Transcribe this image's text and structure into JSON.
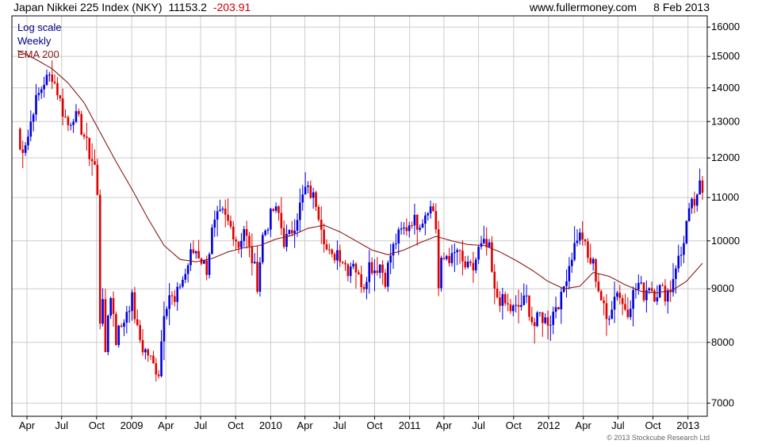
{
  "header": {
    "title": "Japan Nikkei 225 Index (NKY)",
    "last": "11153.2",
    "change": "-203.91",
    "site": "www.fullermoney.com",
    "date": "8 Feb 2013"
  },
  "legend": {
    "scale": "Log scale",
    "period": "Weekly",
    "ema": "EMA 200"
  },
  "copyright": "© 2013 Stockcube Research Ltd",
  "colors": {
    "up": "#0000dd",
    "down": "#dd0000",
    "ema": "#8b1a1a",
    "grid": "#cccccc",
    "scale_text": "#00008b",
    "ema_text": "#8b1a1a",
    "change_text": "#cc0000"
  },
  "chart_data": {
    "type": "candlestick",
    "scale": "log",
    "ylim": [
      6800,
      16400
    ],
    "y_ticks": [
      7000,
      8000,
      9000,
      10000,
      11000,
      12000,
      13000,
      14000,
      15000,
      16000
    ],
    "y_tick_labels": [
      "7000",
      "8000",
      "9000",
      "10000",
      "11000",
      "12000",
      "13000",
      "14000",
      "15000",
      "16000"
    ],
    "x_start": "2008-03-07",
    "x_end": "2013-02-08",
    "x_ticks": [
      {
        "date": "2008-04-01",
        "label": "Apr"
      },
      {
        "date": "2008-07-01",
        "label": "Jul"
      },
      {
        "date": "2008-10-01",
        "label": "Oct"
      },
      {
        "date": "2009-01-01",
        "label": "2009"
      },
      {
        "date": "2009-04-01",
        "label": "Apr"
      },
      {
        "date": "2009-07-01",
        "label": "Jul"
      },
      {
        "date": "2009-10-01",
        "label": "Oct"
      },
      {
        "date": "2010-01-01",
        "label": "2010"
      },
      {
        "date": "2010-04-01",
        "label": "Apr"
      },
      {
        "date": "2010-07-01",
        "label": "Jul"
      },
      {
        "date": "2010-10-01",
        "label": "Oct"
      },
      {
        "date": "2011-01-01",
        "label": "2011"
      },
      {
        "date": "2011-04-01",
        "label": "Apr"
      },
      {
        "date": "2011-07-01",
        "label": "Jul"
      },
      {
        "date": "2011-10-01",
        "label": "Oct"
      },
      {
        "date": "2012-01-01",
        "label": "2012"
      },
      {
        "date": "2012-04-01",
        "label": "Apr"
      },
      {
        "date": "2012-07-01",
        "label": "Jul"
      },
      {
        "date": "2012-10-01",
        "label": "Oct"
      },
      {
        "date": "2013-01-01",
        "label": "2013"
      }
    ],
    "close_path": [
      [
        "2008-03-07",
        12800
      ],
      [
        "2008-03-14",
        12200
      ],
      [
        "2008-03-21",
        12300
      ],
      [
        "2008-04-04",
        12600
      ],
      [
        "2008-04-18",
        13400
      ],
      [
        "2008-05-02",
        13800
      ],
      [
        "2008-05-16",
        14200
      ],
      [
        "2008-06-06",
        14400
      ],
      [
        "2008-06-20",
        13900
      ],
      [
        "2008-07-04",
        13300
      ],
      [
        "2008-07-18",
        12900
      ],
      [
        "2008-08-01",
        13200
      ],
      [
        "2008-08-15",
        13000
      ],
      [
        "2008-08-29",
        12600
      ],
      [
        "2008-09-12",
        12100
      ],
      [
        "2008-09-26",
        11800
      ],
      [
        "2008-10-03",
        11000
      ],
      [
        "2008-10-10",
        8400
      ],
      [
        "2008-10-17",
        8900
      ],
      [
        "2008-10-24",
        7700
      ],
      [
        "2008-10-31",
        8500
      ],
      [
        "2008-11-07",
        8900
      ],
      [
        "2008-11-14",
        8500
      ],
      [
        "2008-11-21",
        8000
      ],
      [
        "2008-11-28",
        8400
      ],
      [
        "2008-12-05",
        8200
      ],
      [
        "2008-12-19",
        8600
      ],
      [
        "2009-01-02",
        8800
      ],
      [
        "2009-01-16",
        8200
      ],
      [
        "2009-01-30",
        7900
      ],
      [
        "2009-02-13",
        7800
      ],
      [
        "2009-02-27",
        7600
      ],
      [
        "2009-03-13",
        7500
      ],
      [
        "2009-03-27",
        8600
      ],
      [
        "2009-04-10",
        8900
      ],
      [
        "2009-04-24",
        8700
      ],
      [
        "2009-05-08",
        9100
      ],
      [
        "2009-05-22",
        9300
      ],
      [
        "2009-06-05",
        9700
      ],
      [
        "2009-06-19",
        9800
      ],
      [
        "2009-07-03",
        9600
      ],
      [
        "2009-07-17",
        9400
      ],
      [
        "2009-07-31",
        10200
      ],
      [
        "2009-08-14",
        10500
      ],
      [
        "2009-08-28",
        10600
      ],
      [
        "2009-09-11",
        10400
      ],
      [
        "2009-09-25",
        10200
      ],
      [
        "2009-10-09",
        9900
      ],
      [
        "2009-10-23",
        10300
      ],
      [
        "2009-11-06",
        9800
      ],
      [
        "2009-11-20",
        9400
      ],
      [
        "2009-11-27",
        9100
      ],
      [
        "2009-12-11",
        10100
      ],
      [
        "2009-12-25",
        10400
      ],
      [
        "2010-01-08",
        10700
      ],
      [
        "2010-01-22",
        10600
      ],
      [
        "2010-02-05",
        10000
      ],
      [
        "2010-02-19",
        10100
      ],
      [
        "2010-03-05",
        10400
      ],
      [
        "2010-03-19",
        10800
      ],
      [
        "2010-04-02",
        11200
      ],
      [
        "2010-04-16",
        11100
      ],
      [
        "2010-04-30",
        10900
      ],
      [
        "2010-05-14",
        10400
      ],
      [
        "2010-05-28",
        9800
      ],
      [
        "2010-06-11",
        9600
      ],
      [
        "2010-06-25",
        9800
      ],
      [
        "2010-07-09",
        9600
      ],
      [
        "2010-07-23",
        9400
      ],
      [
        "2010-08-06",
        9600
      ],
      [
        "2010-08-20",
        9200
      ],
      [
        "2010-09-03",
        9100
      ],
      [
        "2010-09-17",
        9500
      ],
      [
        "2010-10-01",
        9400
      ],
      [
        "2010-10-15",
        9500
      ],
      [
        "2010-10-29",
        9200
      ],
      [
        "2010-11-12",
        9700
      ],
      [
        "2010-11-26",
        10000
      ],
      [
        "2010-12-10",
        10200
      ],
      [
        "2010-12-24",
        10300
      ],
      [
        "2011-01-07",
        10500
      ],
      [
        "2011-01-21",
        10400
      ],
      [
        "2011-02-04",
        10500
      ],
      [
        "2011-02-18",
        10800
      ],
      [
        "2011-03-04",
        10700
      ],
      [
        "2011-03-11",
        10300
      ],
      [
        "2011-03-18",
        9000
      ],
      [
        "2011-03-25",
        9500
      ],
      [
        "2011-04-08",
        9700
      ],
      [
        "2011-04-22",
        9600
      ],
      [
        "2011-05-06",
        9800
      ],
      [
        "2011-05-20",
        9500
      ],
      [
        "2011-06-03",
        9400
      ],
      [
        "2011-06-17",
        9400
      ],
      [
        "2011-07-01",
        9800
      ],
      [
        "2011-07-15",
        9900
      ],
      [
        "2011-07-29",
        9800
      ],
      [
        "2011-08-05",
        9300
      ],
      [
        "2011-08-12",
        8900
      ],
      [
        "2011-08-26",
        8800
      ],
      [
        "2011-09-09",
        8700
      ],
      [
        "2011-09-23",
        8600
      ],
      [
        "2011-10-07",
        8600
      ],
      [
        "2011-10-21",
        8700
      ],
      [
        "2011-11-04",
        8800
      ],
      [
        "2011-11-18",
        8400
      ],
      [
        "2011-11-25",
        8300
      ],
      [
        "2011-12-09",
        8500
      ],
      [
        "2011-12-23",
        8400
      ],
      [
        "2012-01-06",
        8400
      ],
      [
        "2012-01-20",
        8700
      ],
      [
        "2012-02-03",
        8800
      ],
      [
        "2012-02-17",
        9300
      ],
      [
        "2012-03-02",
        9700
      ],
      [
        "2012-03-16",
        10100
      ],
      [
        "2012-03-30",
        10100
      ],
      [
        "2012-04-13",
        9600
      ],
      [
        "2012-04-27",
        9500
      ],
      [
        "2012-05-11",
        9000
      ],
      [
        "2012-05-25",
        8600
      ],
      [
        "2012-06-01",
        8400
      ],
      [
        "2012-06-15",
        8700
      ],
      [
        "2012-06-29",
        9000
      ],
      [
        "2012-07-13",
        8700
      ],
      [
        "2012-07-27",
        8600
      ],
      [
        "2012-08-10",
        8900
      ],
      [
        "2012-08-24",
        9100
      ],
      [
        "2012-09-07",
        8900
      ],
      [
        "2012-09-21",
        9100
      ],
      [
        "2012-10-05",
        8900
      ],
      [
        "2012-10-19",
        9000
      ],
      [
        "2012-11-02",
        8900
      ],
      [
        "2012-11-16",
        9000
      ],
      [
        "2012-11-30",
        9500
      ],
      [
        "2012-12-14",
        9700
      ],
      [
        "2012-12-28",
        10400
      ],
      [
        "2013-01-11",
        10800
      ],
      [
        "2013-01-25",
        10900
      ],
      [
        "2013-02-01",
        11300
      ],
      [
        "2013-02-08",
        11150
      ]
    ],
    "ema_200": [
      [
        "2008-03-07",
        15200
      ],
      [
        "2008-04-25",
        14900
      ],
      [
        "2008-06-06",
        14600
      ],
      [
        "2008-07-18",
        14150
      ],
      [
        "2008-08-29",
        13550
      ],
      [
        "2008-10-10",
        12700
      ],
      [
        "2008-11-21",
        11900
      ],
      [
        "2009-01-02",
        11200
      ],
      [
        "2009-02-13",
        10500
      ],
      [
        "2009-03-27",
        9900
      ],
      [
        "2009-05-08",
        9600
      ],
      [
        "2009-06-19",
        9550
      ],
      [
        "2009-07-31",
        9620
      ],
      [
        "2009-09-11",
        9760
      ],
      [
        "2009-10-23",
        9850
      ],
      [
        "2009-12-04",
        9900
      ],
      [
        "2010-01-15",
        10040
      ],
      [
        "2010-02-26",
        10120
      ],
      [
        "2010-04-09",
        10280
      ],
      [
        "2010-05-21",
        10350
      ],
      [
        "2010-07-02",
        10200
      ],
      [
        "2010-08-13",
        10000
      ],
      [
        "2010-09-24",
        9800
      ],
      [
        "2010-11-05",
        9700
      ],
      [
        "2010-12-17",
        9800
      ],
      [
        "2011-01-28",
        9960
      ],
      [
        "2011-03-11",
        10100
      ],
      [
        "2011-04-22",
        10000
      ],
      [
        "2011-06-03",
        9920
      ],
      [
        "2011-07-15",
        9900
      ],
      [
        "2011-08-26",
        9760
      ],
      [
        "2011-10-07",
        9580
      ],
      [
        "2011-11-18",
        9380
      ],
      [
        "2011-12-30",
        9150
      ],
      [
        "2012-02-10",
        9000
      ],
      [
        "2012-03-23",
        9050
      ],
      [
        "2012-04-27",
        9330
      ],
      [
        "2012-06-08",
        9250
      ],
      [
        "2012-07-20",
        9080
      ],
      [
        "2012-08-31",
        8950
      ],
      [
        "2012-10-12",
        8920
      ],
      [
        "2012-11-23",
        8980
      ],
      [
        "2012-12-28",
        9150
      ],
      [
        "2013-02-08",
        9520
      ]
    ]
  }
}
